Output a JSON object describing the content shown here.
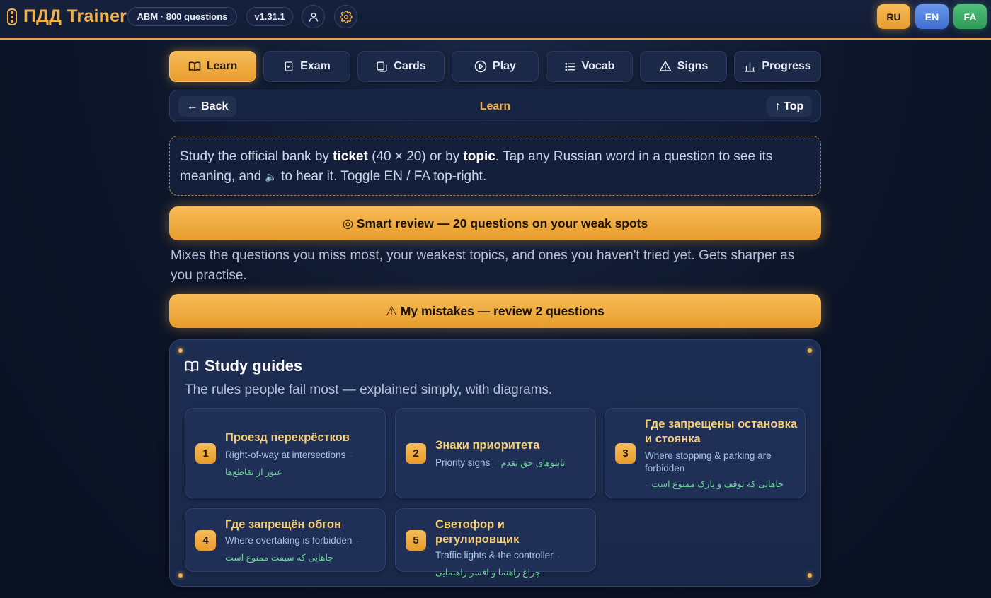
{
  "header": {
    "brand": "ПДД Trainer",
    "questions_pill": "ABM · 800 questions",
    "version_pill": "v1.31.1",
    "languages": [
      "RU",
      "EN",
      "FA"
    ]
  },
  "tabs": [
    {
      "label": "Learn",
      "icon": "book-icon",
      "active": true
    },
    {
      "label": "Exam",
      "icon": "checklist-icon"
    },
    {
      "label": "Cards",
      "icon": "cards-icon"
    },
    {
      "label": "Play",
      "icon": "play-icon"
    },
    {
      "label": "Vocab",
      "icon": "list-icon"
    },
    {
      "label": "Signs",
      "icon": "warning-icon"
    },
    {
      "label": "Progress",
      "icon": "bar-chart-icon"
    }
  ],
  "nav": {
    "back": "← Back",
    "title": "Learn",
    "top": "↑ Top"
  },
  "intro": {
    "p1": "Study the official bank by ",
    "ticket": "ticket",
    "p2": " (40 × 20) or by ",
    "topic": "topic",
    "p3": ". Tap any Russian word in a question to see its meaning, and ",
    "speaker": "🔈",
    "p4": " to hear it. Toggle EN / FA top-right."
  },
  "smart_review": {
    "label": "◎ Smart review — 20 questions on your weak spots",
    "description": "Mixes the questions you miss most, your weakest topics, and ones you haven't tried yet. Gets sharper as you practise."
  },
  "mistakes": {
    "label": "⚠ My mistakes — review 2 questions"
  },
  "guides": {
    "title": "Study guides",
    "subtitle": "The rules people fail most — explained simply, with diagrams.",
    "items": [
      {
        "num": "1",
        "ru": "Проезд перекрёстков",
        "en": "Right-of-way at intersections",
        "fa": "عبور از تقاطع‌ها"
      },
      {
        "num": "2",
        "ru": "Знаки приоритета",
        "en": "Priority signs",
        "fa": "تابلوهای حق تقدم"
      },
      {
        "num": "3",
        "ru": "Где запрещены остановка и стоянка",
        "en": "Where stopping & parking are forbidden",
        "fa": "جاهایی که توقف و پارک ممنوع است"
      },
      {
        "num": "4",
        "ru": "Где запрещён обгон",
        "en": "Where overtaking is forbidden",
        "fa": "جاهایی که سبقت ممنوع است"
      },
      {
        "num": "5",
        "ru": "Светофор и регулировщик",
        "en": "Traffic lights & the controller",
        "fa": "چراغ راهنما و افسر راهنمایی"
      }
    ]
  },
  "colors": {
    "accent": "#f2b24a",
    "background": "#0d1529",
    "card": "#1f2f55",
    "farsi": "#6fd59a",
    "english": "#a9c3ee"
  }
}
